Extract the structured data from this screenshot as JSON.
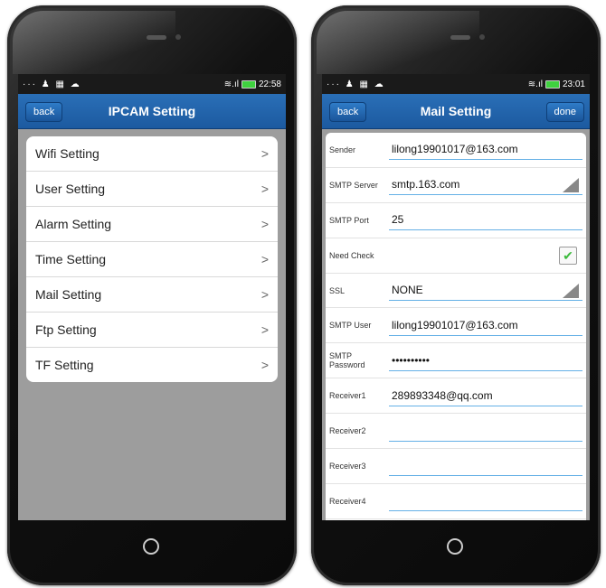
{
  "left_phone": {
    "status": {
      "left_icons": "··· ♟ ▦ ☁",
      "time": "22:58"
    },
    "header": {
      "back_label": "back",
      "title": "IPCAM  Setting"
    },
    "menu": [
      {
        "label": "Wifi Setting"
      },
      {
        "label": "User Setting"
      },
      {
        "label": "Alarm Setting"
      },
      {
        "label": "Time Setting"
      },
      {
        "label": "Mail Setting"
      },
      {
        "label": "Ftp Setting"
      },
      {
        "label": "TF Setting"
      }
    ],
    "chevron": ">"
  },
  "right_phone": {
    "status": {
      "left_icons": "··· ♟ ▦ ☁",
      "time": "23:01"
    },
    "header": {
      "back_label": "back",
      "title": "Mail Setting",
      "done_label": "done"
    },
    "form": {
      "sender": {
        "label": "Sender",
        "value": "lilong19901017@163.com"
      },
      "smtp_server": {
        "label": "SMTP Server",
        "value": "smtp.163.com"
      },
      "smtp_port": {
        "label": "SMTP Port",
        "value": "25"
      },
      "need_check": {
        "label": "Need Check",
        "checked": "✔"
      },
      "ssl": {
        "label": "SSL",
        "value": "NONE"
      },
      "smtp_user": {
        "label": "SMTP User",
        "value": "lilong19901017@163.com"
      },
      "smtp_password": {
        "label": "SMTP Password",
        "value": "••••••••••"
      },
      "receiver1": {
        "label": "Receiver1",
        "value": "289893348@qq.com"
      },
      "receiver2": {
        "label": "Receiver2",
        "value": ""
      },
      "receiver3": {
        "label": "Receiver3",
        "value": ""
      },
      "receiver4": {
        "label": "Receiver4",
        "value": ""
      }
    }
  },
  "colors": {
    "header_blue": "#1c5aa0",
    "field_line": "#64b0e6",
    "check_green": "#3cba3c"
  },
  "home_button": "○"
}
